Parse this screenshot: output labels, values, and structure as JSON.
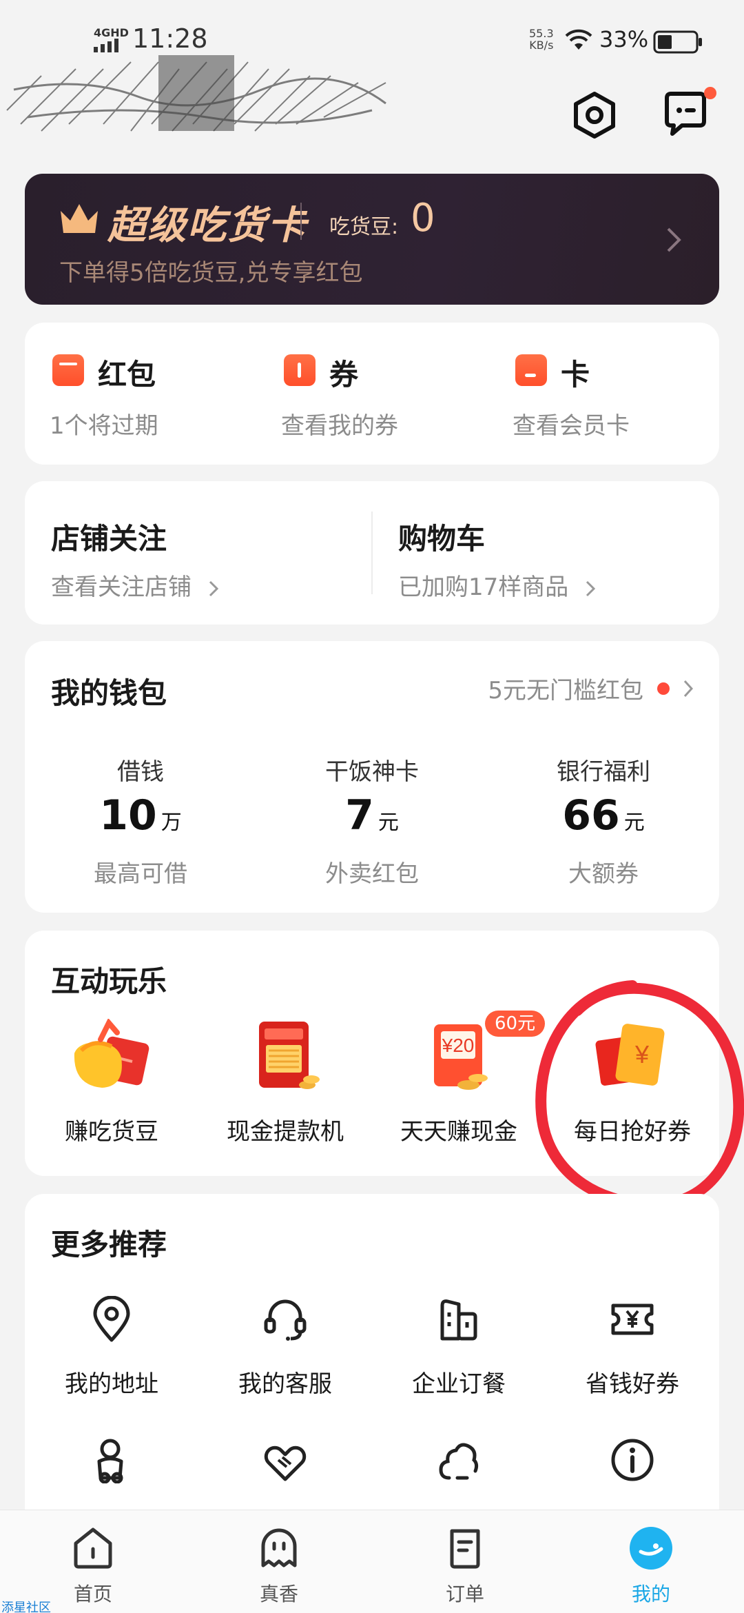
{
  "status_bar": {
    "network": "4GHD",
    "time": "11:28",
    "speed_value": "55.3",
    "speed_unit": "KB/s",
    "battery": "33%"
  },
  "header": {
    "settings_icon": "settings-hexagon-icon",
    "message_icon": "message-bubble-icon"
  },
  "member": {
    "title": "超级吃货卡",
    "beans_label": "吃货豆:",
    "beans_value": "0",
    "subtitle": "下单得5倍吃货豆,兑专享红包"
  },
  "assets": [
    {
      "label": "红包",
      "sub": "1个将过期"
    },
    {
      "label": "券",
      "sub": "查看我的券"
    },
    {
      "label": "卡",
      "sub": "查看会员卡"
    }
  ],
  "shortcuts": [
    {
      "title": "店铺关注",
      "sub": "查看关注店铺"
    },
    {
      "title": "购物车",
      "sub": "已加购17样商品"
    }
  ],
  "wallet": {
    "title": "我的钱包",
    "promo": "5元无门槛红包",
    "items": [
      {
        "label": "借钱",
        "value": "10",
        "unit": "万",
        "desc": "最高可借"
      },
      {
        "label": "干饭神卡",
        "value": "7",
        "unit": "元",
        "desc": "外卖红包"
      },
      {
        "label": "银行福利",
        "value": "66",
        "unit": "元",
        "desc": "大额券"
      }
    ]
  },
  "games": {
    "title": "互动玩乐",
    "items": [
      {
        "label": "赚吃货豆"
      },
      {
        "label": "现金提款机"
      },
      {
        "label": "天天赚现金",
        "badge": "60元",
        "amount": "¥20"
      },
      {
        "label": "每日抢好券",
        "symbol": "¥"
      }
    ]
  },
  "more": {
    "title": "更多推荐",
    "items": [
      {
        "label": "我的地址",
        "icon": "location-pin-icon"
      },
      {
        "label": "我的客服",
        "icon": "headset-icon"
      },
      {
        "label": "企业订餐",
        "icon": "building-icon"
      },
      {
        "label": "省钱好券",
        "icon": "coupon-yen-icon"
      },
      {
        "label": "",
        "icon": "scooter-icon"
      },
      {
        "label": "",
        "icon": "handshake-icon"
      },
      {
        "label": "",
        "icon": "cloud-icon"
      },
      {
        "label": "",
        "icon": "info-icon"
      }
    ]
  },
  "nav": {
    "items": [
      {
        "label": "首页",
        "icon": "home-icon"
      },
      {
        "label": "真香",
        "icon": "ghost-face-icon"
      },
      {
        "label": "订单",
        "icon": "order-list-icon"
      },
      {
        "label": "我的",
        "icon": "profile-icon"
      }
    ],
    "active_index": 3
  },
  "watermark": "添星社区",
  "colors": {
    "accent_red": "#ff4f2b",
    "active_blue": "#1aa7e6",
    "banner_bg": "#2a1f2c",
    "banner_gold": "#f5c39a"
  }
}
